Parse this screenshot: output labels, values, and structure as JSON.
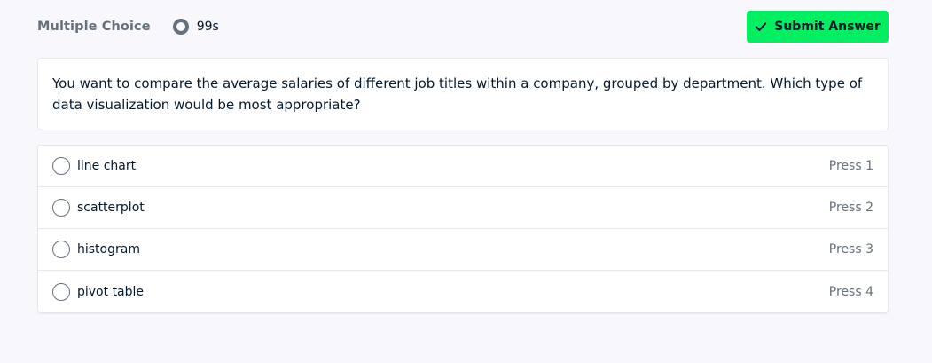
{
  "header": {
    "mode_label": "Multiple Choice",
    "timer_text": "99s",
    "timer_icon": "progress-ring-icon",
    "submit_label": "Submit Answer",
    "submit_icon": "checkmark-icon"
  },
  "question": {
    "text": "You want to compare the average salaries of different job titles within a company, grouped by department. Which type of data visualization would be most appropriate?"
  },
  "options": [
    {
      "label": "line chart",
      "shortcut": "Press 1"
    },
    {
      "label": "scatterplot",
      "shortcut": "Press 2"
    },
    {
      "label": "histogram",
      "shortcut": "Press 3"
    },
    {
      "label": "pivot table",
      "shortcut": "Press 4"
    }
  ],
  "colors": {
    "accent_green": "#03ef62",
    "text_dark": "#05192d",
    "text_muted": "#65707d",
    "background": "#f7f7fc",
    "border": "#e6e7ec"
  }
}
